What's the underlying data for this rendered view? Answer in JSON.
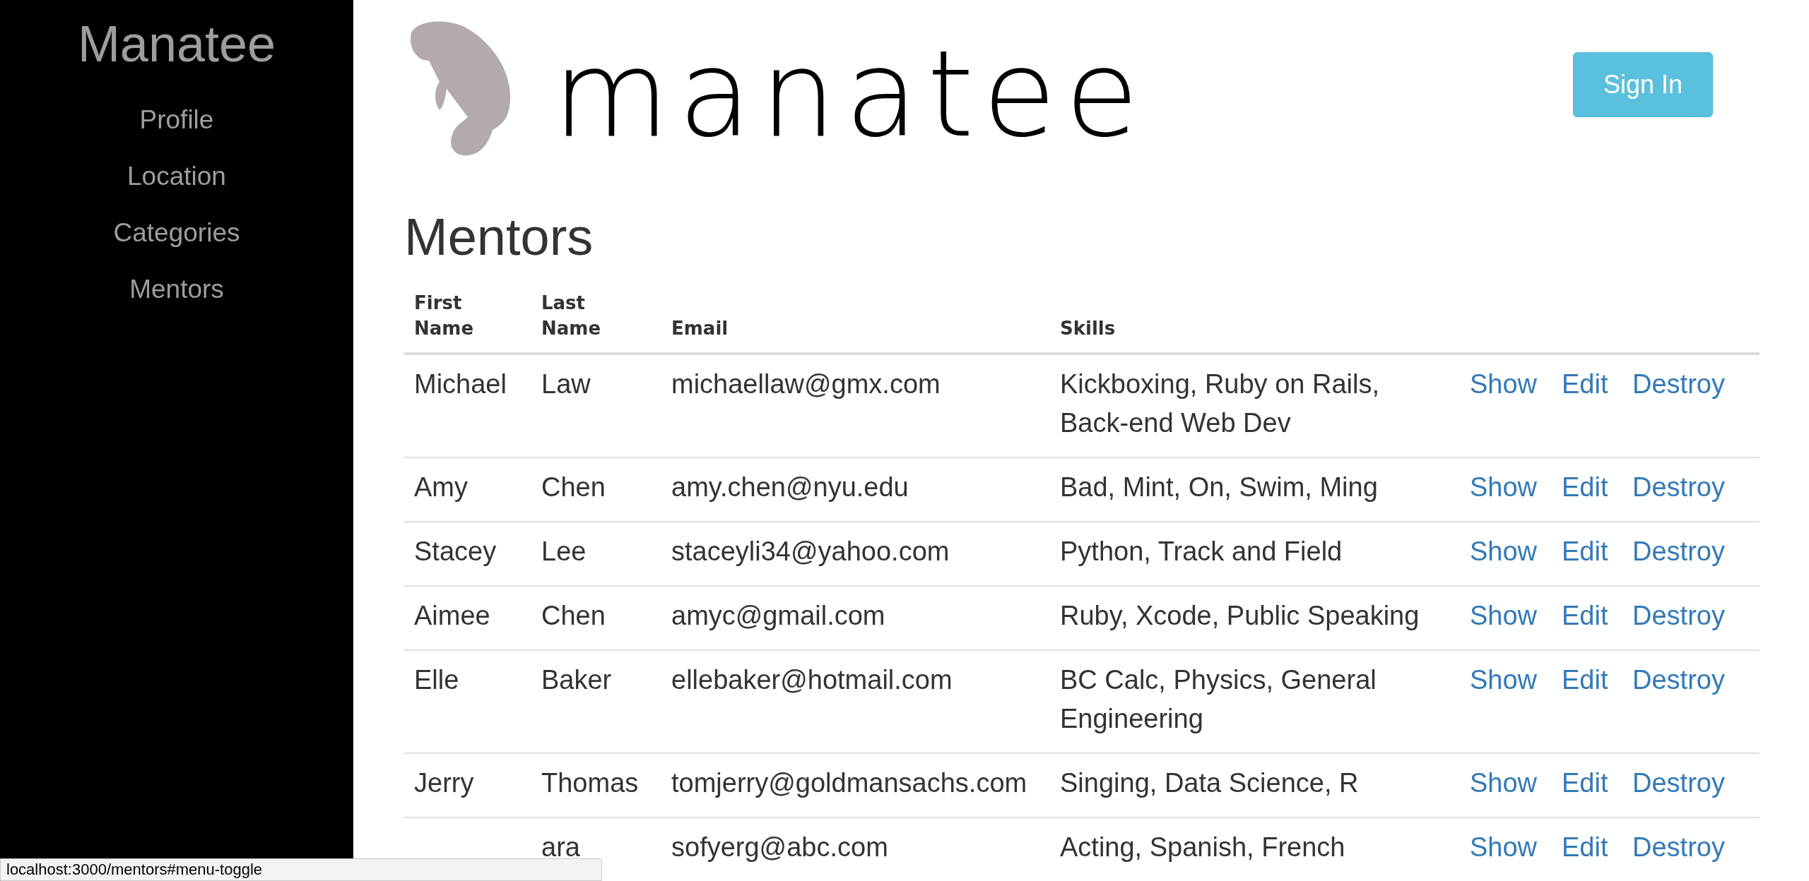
{
  "sidebar": {
    "title": "Manatee",
    "items": [
      "Profile",
      "Location",
      "Categories",
      "Mentors"
    ]
  },
  "header": {
    "logo_text": "manatee",
    "sign_in": "Sign In"
  },
  "page_title": "Mentors",
  "table": {
    "columns": [
      "First\nName",
      "Last\nName",
      "Email",
      "Skills"
    ],
    "rows": [
      {
        "first_name": "Michael",
        "last_name": "Law",
        "email": "michaellaw@gmx.com",
        "skills": "Kickboxing, Ruby on Rails, Back-end Web Dev",
        "actions": [
          "Show",
          "Edit",
          "Destroy"
        ]
      },
      {
        "first_name": "Amy",
        "last_name": "Chen",
        "email": "amy.chen@nyu.edu",
        "skills": "Bad, Mint, On, Swim, Ming",
        "actions": [
          "Show",
          "Edit",
          "Destroy"
        ]
      },
      {
        "first_name": "Stacey",
        "last_name": "Lee",
        "email": "staceyli34@yahoo.com",
        "skills": "Python, Track and Field",
        "actions": [
          "Show",
          "Edit",
          "Destroy"
        ]
      },
      {
        "first_name": "Aimee",
        "last_name": "Chen",
        "email": "amyc@gmail.com",
        "skills": "Ruby, Xcode, Public Speaking",
        "actions": [
          "Show",
          "Edit",
          "Destroy"
        ]
      },
      {
        "first_name": "Elle",
        "last_name": "Baker",
        "email": "ellebaker@hotmail.com",
        "skills": "BC Calc, Physics, General Engineering",
        "actions": [
          "Show",
          "Edit",
          "Destroy"
        ]
      },
      {
        "first_name": "Jerry",
        "last_name": "Thomas",
        "email": "tomjerry@goldmansachs.com",
        "skills": "Singing, Data Science, R",
        "actions": [
          "Show",
          "Edit",
          "Destroy"
        ]
      },
      {
        "last_name": "ara",
        "email": "sofyerg@abc.com",
        "skills": "Acting, Spanish, French",
        "actions": [
          "Show",
          "Edit",
          "Destroy"
        ]
      }
    ]
  },
  "status_bar": "localhost:3000/mentors#menu-toggle"
}
